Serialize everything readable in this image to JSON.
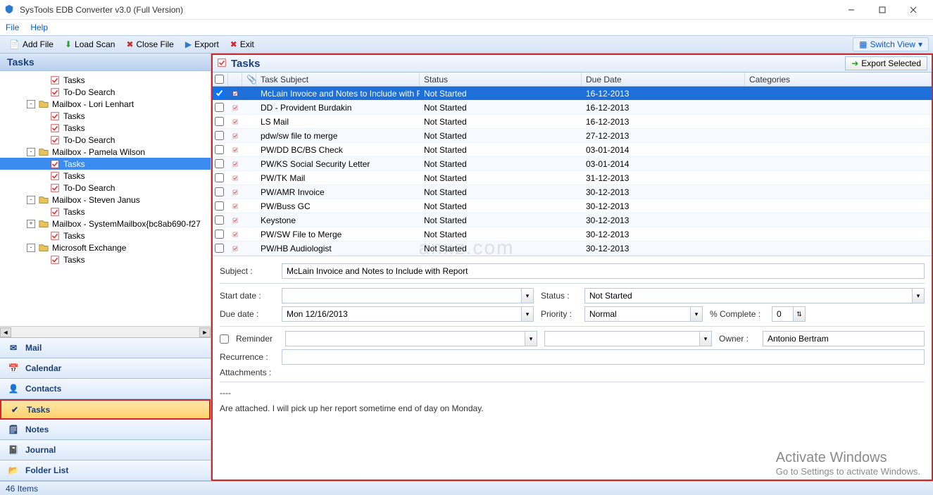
{
  "window": {
    "title": "SysTools EDB Converter v3.0 (Full Version)"
  },
  "menubar": {
    "file": "File",
    "help": "Help"
  },
  "toolbar": {
    "add_file": "Add File",
    "load_scan": "Load Scan",
    "close_file": "Close File",
    "export": "Export",
    "exit": "Exit",
    "switch_view": "Switch View"
  },
  "left": {
    "header": "Tasks",
    "tree": [
      {
        "level": 3,
        "toggle": "",
        "icon": "task",
        "label": "Tasks",
        "selected": false
      },
      {
        "level": 3,
        "toggle": "",
        "icon": "task",
        "label": "To-Do Search",
        "selected": false
      },
      {
        "level": 2,
        "toggle": "-",
        "icon": "mailbox",
        "label": "Mailbox - Lori Lenhart",
        "selected": false
      },
      {
        "level": 3,
        "toggle": "",
        "icon": "task",
        "label": "Tasks",
        "selected": false
      },
      {
        "level": 3,
        "toggle": "",
        "icon": "task",
        "label": "Tasks",
        "selected": false
      },
      {
        "level": 3,
        "toggle": "",
        "icon": "task",
        "label": "To-Do Search",
        "selected": false
      },
      {
        "level": 2,
        "toggle": "-",
        "icon": "mailbox",
        "label": "Mailbox - Pamela Wilson",
        "selected": false
      },
      {
        "level": 3,
        "toggle": "",
        "icon": "task",
        "label": "Tasks",
        "selected": true
      },
      {
        "level": 3,
        "toggle": "",
        "icon": "task",
        "label": "Tasks",
        "selected": false
      },
      {
        "level": 3,
        "toggle": "",
        "icon": "task",
        "label": "To-Do Search",
        "selected": false
      },
      {
        "level": 2,
        "toggle": "-",
        "icon": "mailbox",
        "label": "Mailbox - Steven Janus",
        "selected": false
      },
      {
        "level": 3,
        "toggle": "",
        "icon": "task",
        "label": "Tasks",
        "selected": false
      },
      {
        "level": 2,
        "toggle": "+",
        "icon": "mailbox",
        "label": "Mailbox - SystemMailbox{bc8ab690-f27",
        "selected": false
      },
      {
        "level": 3,
        "toggle": "",
        "icon": "task",
        "label": "Tasks",
        "selected": false
      },
      {
        "level": 2,
        "toggle": "-",
        "icon": "mailbox",
        "label": "Microsoft Exchange",
        "selected": false
      },
      {
        "level": 3,
        "toggle": "",
        "icon": "task",
        "label": "Tasks",
        "selected": false
      }
    ],
    "nav": [
      {
        "icon": "mail",
        "label": "Mail",
        "active": false
      },
      {
        "icon": "calendar",
        "label": "Calendar",
        "active": false
      },
      {
        "icon": "contacts",
        "label": "Contacts",
        "active": false
      },
      {
        "icon": "tasks",
        "label": "Tasks",
        "active": true
      },
      {
        "icon": "notes",
        "label": "Notes",
        "active": false
      },
      {
        "icon": "journal",
        "label": "Journal",
        "active": false
      },
      {
        "icon": "folder",
        "label": "Folder List",
        "active": false
      }
    ]
  },
  "right": {
    "title": "Tasks",
    "export_selected": "Export Selected",
    "columns": {
      "subject": "Task Subject",
      "status": "Status",
      "due": "Due Date",
      "categories": "Categories"
    },
    "rows": [
      {
        "subject": "McLain Invoice and Notes to Include with Re...",
        "status": "Not Started",
        "due": "16-12-2013",
        "selected": true,
        "checked": true
      },
      {
        "subject": "DD - Provident Burdakin",
        "status": "Not Started",
        "due": "16-12-2013",
        "selected": false,
        "checked": false
      },
      {
        "subject": "LS Mail",
        "status": "Not Started",
        "due": "16-12-2013",
        "selected": false,
        "checked": false
      },
      {
        "subject": "pdw/sw file to merge",
        "status": "Not Started",
        "due": "27-12-2013",
        "selected": false,
        "checked": false
      },
      {
        "subject": "PW/DD BC/BS Check",
        "status": "Not Started",
        "due": "03-01-2014",
        "selected": false,
        "checked": false
      },
      {
        "subject": "PW/KS Social Security Letter",
        "status": "Not Started",
        "due": "03-01-2014",
        "selected": false,
        "checked": false
      },
      {
        "subject": "PW/TK Mail",
        "status": "Not Started",
        "due": "31-12-2013",
        "selected": false,
        "checked": false
      },
      {
        "subject": "PW/AMR Invoice",
        "status": "Not Started",
        "due": "30-12-2013",
        "selected": false,
        "checked": false
      },
      {
        "subject": "PW/Buss GC",
        "status": "Not Started",
        "due": "30-12-2013",
        "selected": false,
        "checked": false
      },
      {
        "subject": "Keystone",
        "status": "Not Started",
        "due": "30-12-2013",
        "selected": false,
        "checked": false
      },
      {
        "subject": "PW/SW File to Merge",
        "status": "Not Started",
        "due": "30-12-2013",
        "selected": false,
        "checked": false
      },
      {
        "subject": "PW/HB Audiologist",
        "status": "Not Started",
        "due": "30-12-2013",
        "selected": false,
        "checked": false
      }
    ]
  },
  "detail": {
    "labels": {
      "subject": "Subject :",
      "start_date": "Start date :",
      "due_date": "Due date :",
      "status": "Status :",
      "priority": "Priority :",
      "pct_complete": "% Complete :",
      "reminder": "Reminder",
      "owner": "Owner :",
      "recurrence": "Recurrence :",
      "attachments": "Attachments :"
    },
    "values": {
      "subject": "McLain Invoice and Notes to Include with Report",
      "start_date": "",
      "due_date": "Mon 12/16/2013",
      "status": "Not Started",
      "priority": "Normal",
      "pct_complete": "0",
      "reminder_date": "",
      "reminder_time": "",
      "owner": "Antonio Bertram",
      "recurrence": "",
      "body_sep": "----",
      "body": "Are attached.  I will pick up her report sometime end of day on Monday."
    }
  },
  "statusbar": {
    "items": "46 Items"
  },
  "activate": {
    "line1": "Activate Windows",
    "line2": "Go to Settings to activate Windows."
  },
  "watermark": "anxz.com"
}
